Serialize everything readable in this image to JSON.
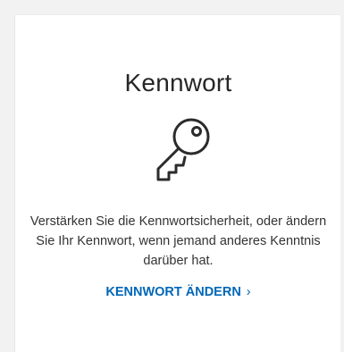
{
  "card": {
    "title": "Kennwort",
    "icon": "key-icon",
    "description": "Verstärken Sie die Kennwortsicherheit, oder ändern Sie Ihr Kennwort, wenn jemand anderes Kenntnis darüber hat.",
    "link_label": "KENNWORT ÄNDERN",
    "link_chevron": "›",
    "link_color": "#0067b8"
  }
}
